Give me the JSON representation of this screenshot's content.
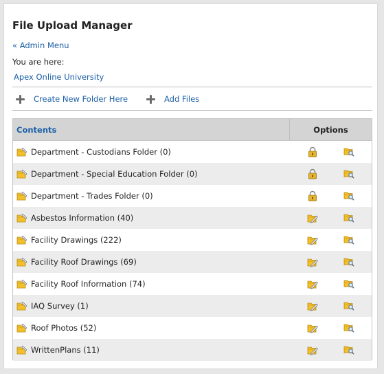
{
  "page": {
    "title": "File Upload Manager",
    "admin_link": "« Admin Menu",
    "you_are_here": "You are here:",
    "breadcrumb": "Apex Online University"
  },
  "actions": {
    "create_folder": "Create New Folder Here",
    "add_files": "Add Files"
  },
  "table": {
    "header_contents": "Contents",
    "header_options": "Options",
    "rows": [
      {
        "label": "Department - Custodians Folder (0)",
        "locked": true
      },
      {
        "label": "Department - Special Education Folder (0)",
        "locked": true
      },
      {
        "label": "Department - Trades Folder (0)",
        "locked": true
      },
      {
        "label": "Asbestos Information (40)",
        "locked": false
      },
      {
        "label": "Facility Drawings (222)",
        "locked": false
      },
      {
        "label": "Facility Roof Drawings (69)",
        "locked": false
      },
      {
        "label": "Facility Roof Information (74)",
        "locked": false
      },
      {
        "label": "IAQ Survey (1)",
        "locked": false
      },
      {
        "label": "Roof Photos (52)",
        "locked": false
      },
      {
        "label": "WrittenPlans (11)",
        "locked": false
      }
    ]
  },
  "colors": {
    "link": "#1b5fa6",
    "header_bg": "#d4d4d4",
    "stripe": "#ececec",
    "folder": "#f2c02c"
  }
}
